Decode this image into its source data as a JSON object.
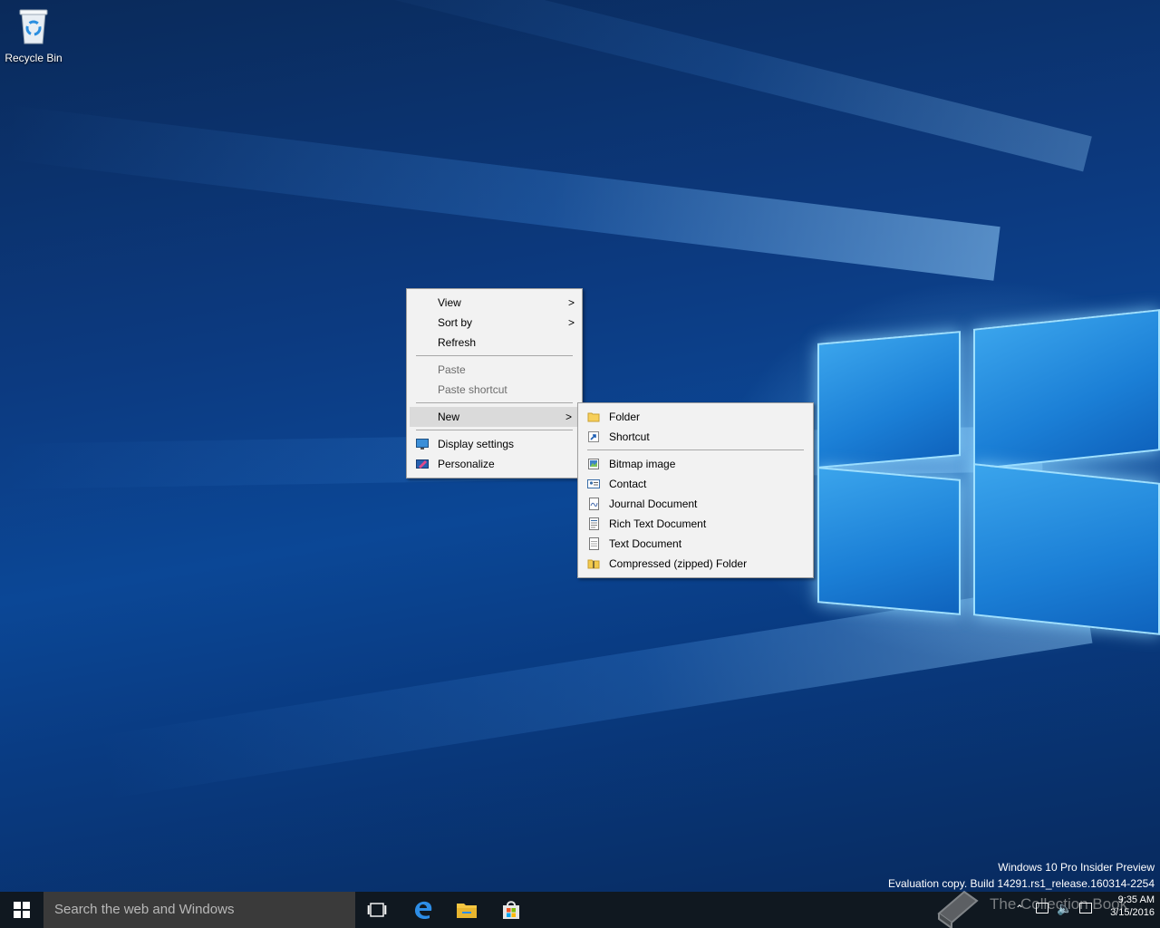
{
  "desktop": {
    "icons": [
      {
        "label": "Recycle Bin",
        "icon": "recycle-bin-icon"
      }
    ],
    "watermark": {
      "line1": "Windows 10 Pro Insider Preview",
      "line2": "Evaluation copy. Build 14291.rs1_release.160314-2254"
    }
  },
  "context_menu": {
    "items": [
      {
        "label": "View",
        "submenu": true
      },
      {
        "label": "Sort by",
        "submenu": true
      },
      {
        "label": "Refresh"
      },
      {
        "label": "Paste",
        "disabled": true
      },
      {
        "label": "Paste shortcut",
        "disabled": true
      },
      {
        "label": "New",
        "submenu": true,
        "highlighted": true
      },
      {
        "label": "Display settings",
        "icon": "display-settings-icon"
      },
      {
        "label": "Personalize",
        "icon": "personalize-icon"
      }
    ],
    "arrow_glyph": ">"
  },
  "new_submenu": {
    "items": [
      {
        "label": "Folder",
        "icon": "folder-icon"
      },
      {
        "label": "Shortcut",
        "icon": "shortcut-icon"
      },
      {
        "label": "Bitmap image",
        "icon": "bitmap-icon"
      },
      {
        "label": "Contact",
        "icon": "contact-icon"
      },
      {
        "label": "Journal Document",
        "icon": "journal-icon"
      },
      {
        "label": "Rich Text Document",
        "icon": "rich-text-icon"
      },
      {
        "label": "Text Document",
        "icon": "text-document-icon"
      },
      {
        "label": "Compressed (zipped) Folder",
        "icon": "zip-folder-icon"
      }
    ]
  },
  "taskbar": {
    "search_placeholder": "Search the web and Windows",
    "pinned": [
      "task-view-icon",
      "edge-icon",
      "file-explorer-icon",
      "store-icon"
    ],
    "tray_watermark": "The Collection Book",
    "time": "9:35 AM",
    "date": "3/15/2016"
  },
  "colors": {
    "accent": "#0078d7",
    "menu_bg": "#f2f2f2",
    "taskbar": "#101820"
  }
}
